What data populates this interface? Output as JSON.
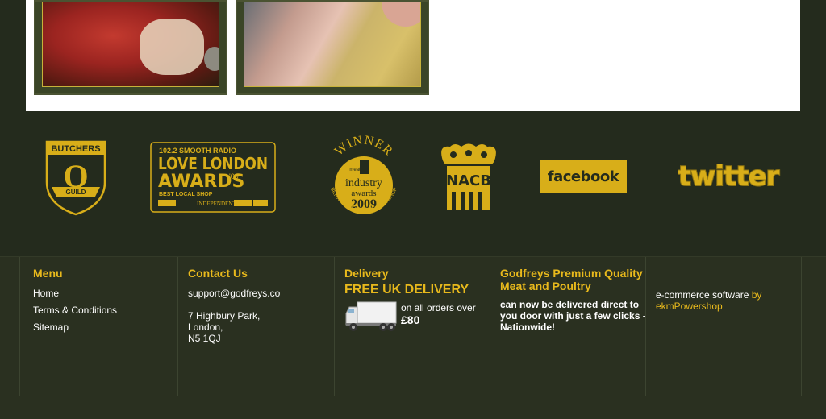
{
  "logos": {
    "butchers_q": {
      "top": "BUTCHERS",
      "letter": "Q",
      "ribbon": "GUILD"
    },
    "love_london": {
      "radio": "102.2 SMOOTH RADIO",
      "title": "LOVE LONDON",
      "awards": "AWARDS",
      "year": "'09",
      "sub": "BEST LOCAL SHOP",
      "independent": "INDEPENDENT"
    },
    "meat_winner": {
      "winner": "WINNER",
      "meat": "meat",
      "industry": "industry",
      "awards": "awards",
      "year": "2009",
      "ring": "BRITAIN'S BEST BUTCHERS SHOP"
    },
    "nacb": {
      "text": "NACB"
    },
    "facebook": {
      "text": "facebook"
    },
    "twitter": {
      "text": "twitter"
    }
  },
  "footer": {
    "menu": {
      "title": "Menu",
      "items": [
        "Home",
        "Terms & Conditions",
        "Sitemap"
      ]
    },
    "contact": {
      "title": "Contact Us",
      "email": "support@godfreys.co",
      "address": [
        "7 Highbury Park,",
        "London,",
        "N5 1QJ"
      ]
    },
    "delivery": {
      "title": "Delivery",
      "headline": "FREE UK DELIVERY",
      "orders": "on all orders over",
      "price": "£80"
    },
    "godfreys": {
      "title": "Godfreys Premium Quality Meat and Poultry",
      "body": "can now be delivered direct to you door with just a few clicks - Nationwide!"
    },
    "ekm": {
      "prefix": "e-commerce software",
      "by": "by",
      "brand": "ekmPowershop"
    }
  },
  "colors": {
    "accent": "#e8b91c",
    "background": "#242b1d",
    "logo_gold": "#d8ae19"
  }
}
